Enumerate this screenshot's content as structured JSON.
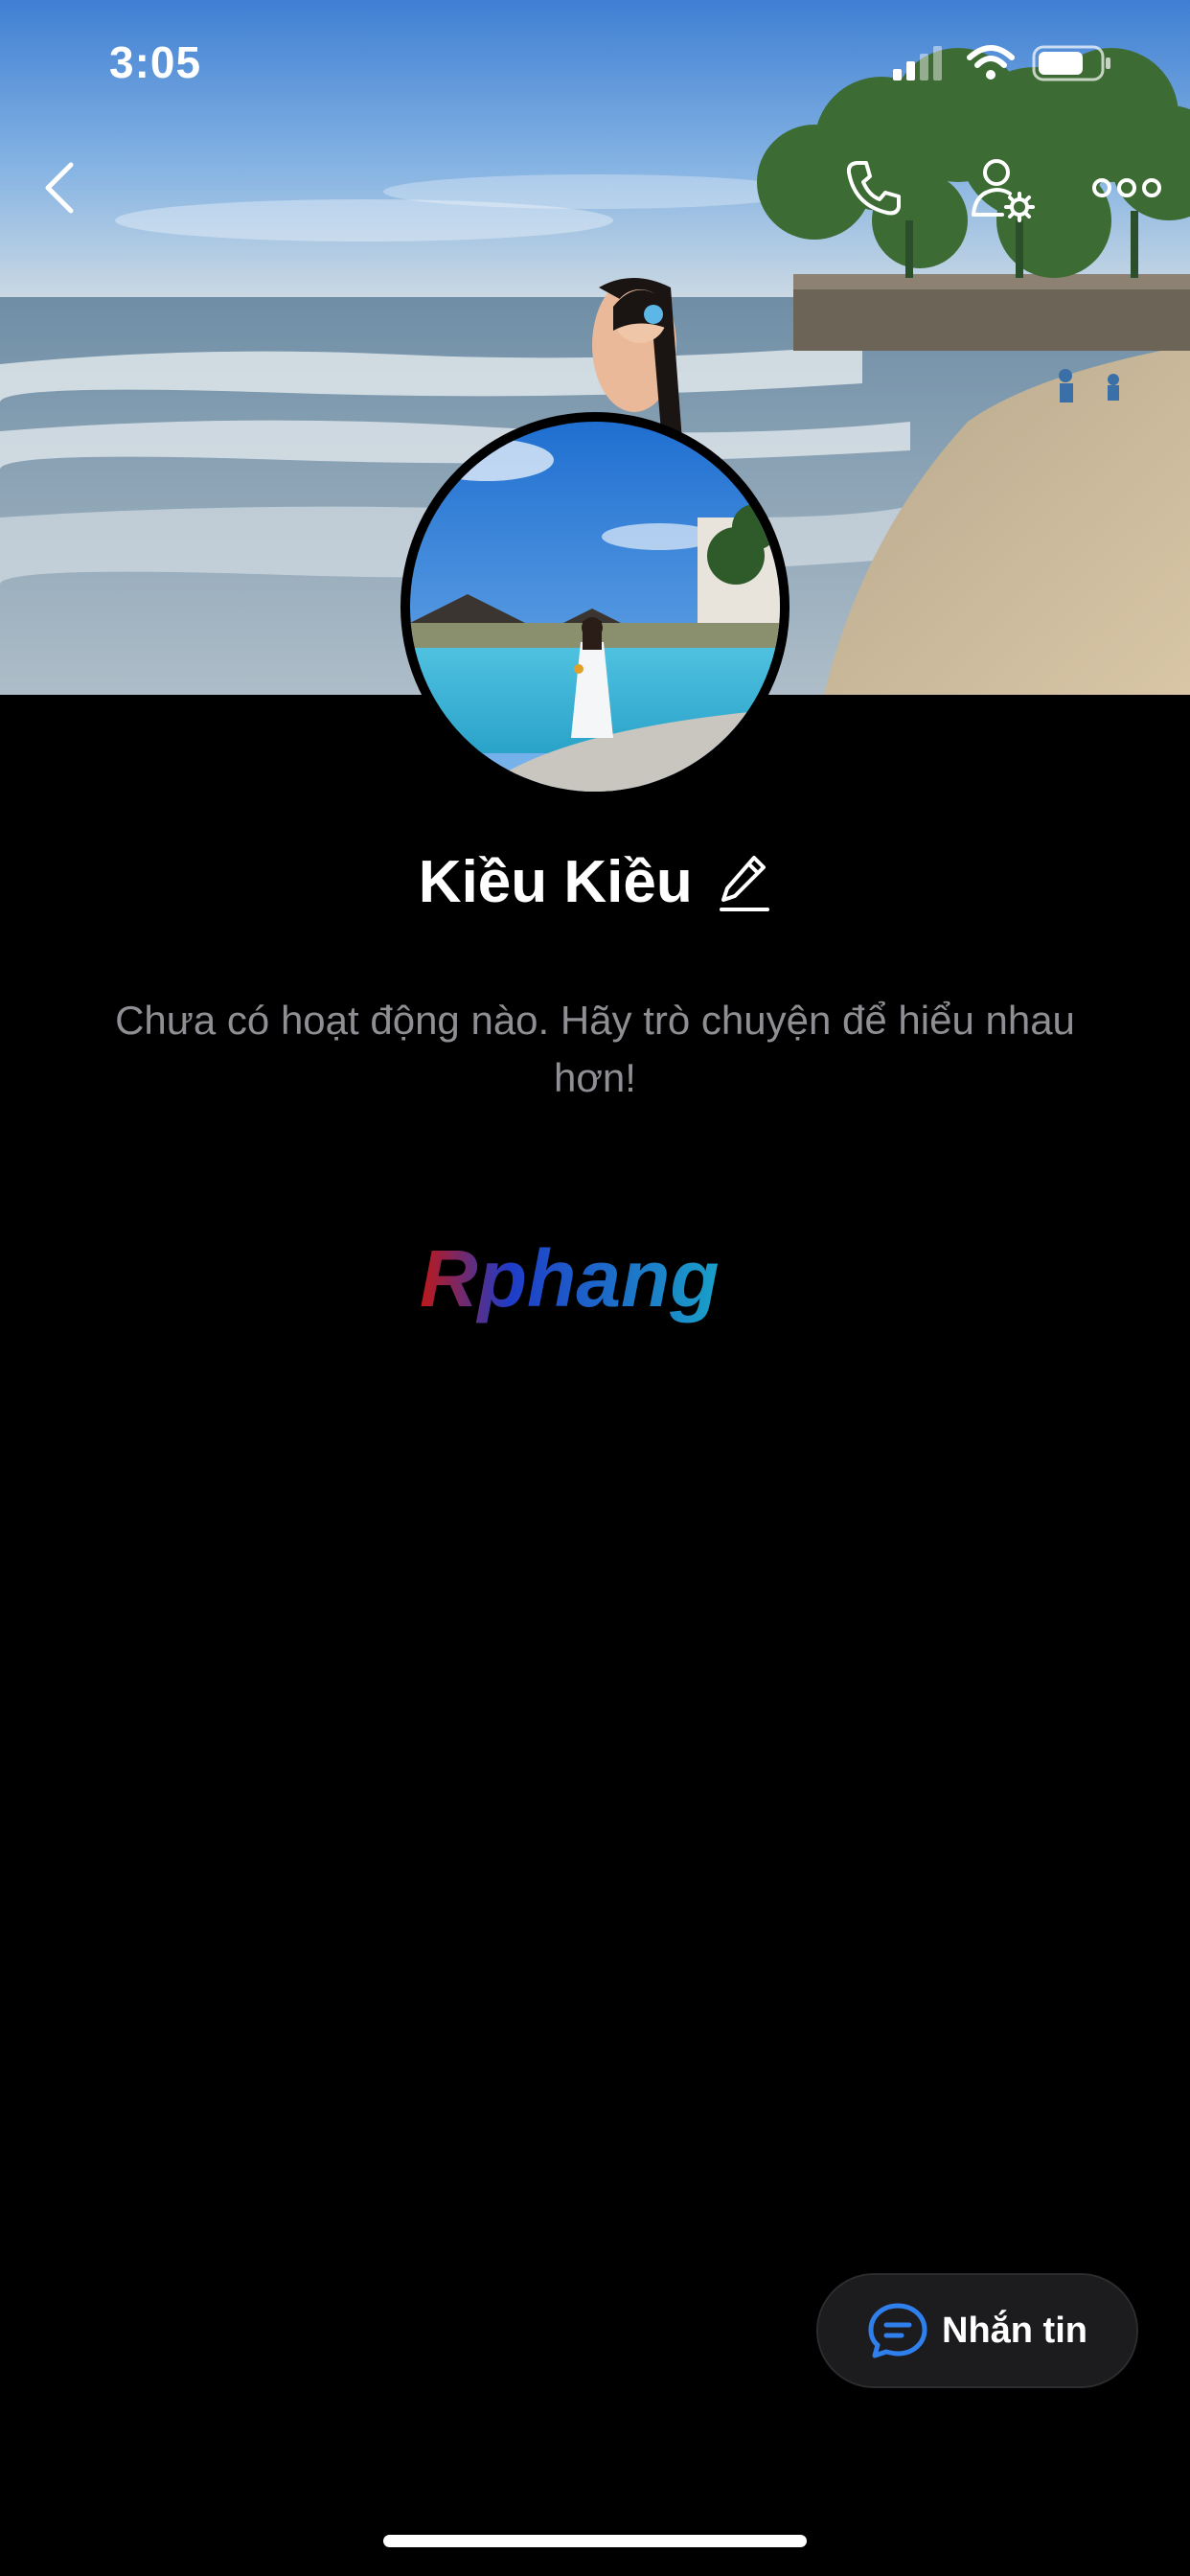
{
  "status_bar": {
    "time": "3:05",
    "signal_icon": "signal-bars-icon",
    "wifi_icon": "wifi-icon",
    "battery_icon": "battery-icon"
  },
  "header": {
    "back_icon": "chevron-left-icon",
    "call_icon": "phone-icon",
    "settings_icon": "user-settings-icon",
    "more_icon": "more-dots-icon"
  },
  "profile": {
    "name": "Kiều Kiều",
    "edit_icon": "pencil-icon",
    "empty_message": "Chưa có hoạt động nào. Hãy trò chuyện để hiểu nhau hơn!"
  },
  "watermark": {
    "text": "Rphang"
  },
  "message_button": {
    "label": "Nhắn tin",
    "icon": "chat-bubble-icon"
  },
  "colors": {
    "background": "#000000",
    "accent": "#2f80ed",
    "secondary_text": "#8e8e93",
    "button_bg": "#1c1c1e"
  }
}
